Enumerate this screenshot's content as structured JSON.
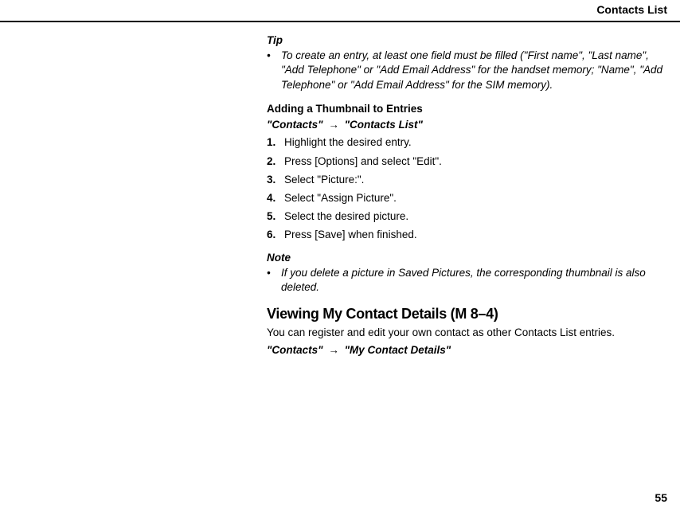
{
  "header": {
    "title": "Contacts List"
  },
  "tip": {
    "label": "Tip",
    "bullet": "•",
    "text": "To create an entry, at least one field must be filled (\"First name\", \"Last name\", \"Add Telephone\"  or \"Add Email Address\" for the handset memory; \"Name\", \"Add Telephone\" or \"Add Email Address\" for the SIM memory)."
  },
  "thumbnail_section": {
    "title": "Adding a Thumbnail to Entries",
    "breadcrumb_a": "\"Contacts\"",
    "breadcrumb_arrow": "→",
    "breadcrumb_b": "\"Contacts List\"",
    "steps": [
      {
        "num": "1.",
        "text": "Highlight the desired entry."
      },
      {
        "num": "2.",
        "text": "Press [Options] and select \"Edit\"."
      },
      {
        "num": "3.",
        "text": "Select \"Picture:\"."
      },
      {
        "num": "4.",
        "text": "Select \"Assign Picture\"."
      },
      {
        "num": "5.",
        "text": "Select the desired picture."
      },
      {
        "num": "6.",
        "text": "Press [Save] when finished."
      }
    ]
  },
  "note": {
    "label": "Note",
    "bullet": "•",
    "text": "If you delete a picture in Saved Pictures, the corresponding thumbnail is also deleted."
  },
  "viewing_section": {
    "title": "Viewing My Contact Details",
    "suffix": " (M 8–4)",
    "body": "You can register and edit your own contact as other Contacts List entries.",
    "breadcrumb_a": "\"Contacts\"",
    "breadcrumb_arrow": "→",
    "breadcrumb_b": "\"My Contact Details\""
  },
  "page_number": "55"
}
